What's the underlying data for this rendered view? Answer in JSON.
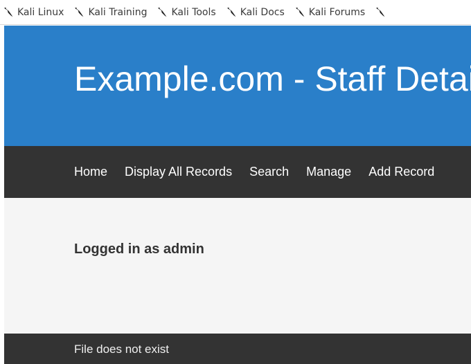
{
  "bookmarks": [
    {
      "label": "Kali Linux",
      "icon": "kali-dragon-icon"
    },
    {
      "label": "Kali Training",
      "icon": "kali-dragon-icon"
    },
    {
      "label": "Kali Tools",
      "icon": "kali-dragon-icon"
    },
    {
      "label": "Kali Docs",
      "icon": "kali-dragon-icon"
    },
    {
      "label": "Kali Forums",
      "icon": "kali-dragon-icon"
    }
  ],
  "header": {
    "title": "Example.com - Staff Details"
  },
  "nav": {
    "items": [
      "Home",
      "Display All Records",
      "Search",
      "Manage",
      "Add Record"
    ]
  },
  "main": {
    "status": "Logged in as admin"
  },
  "footer": {
    "message": "File does not exist"
  },
  "colors": {
    "header_bg": "#2a7fc9",
    "nav_bg": "#333333",
    "content_bg": "#f5f5f5",
    "footer_bg": "#333333"
  }
}
